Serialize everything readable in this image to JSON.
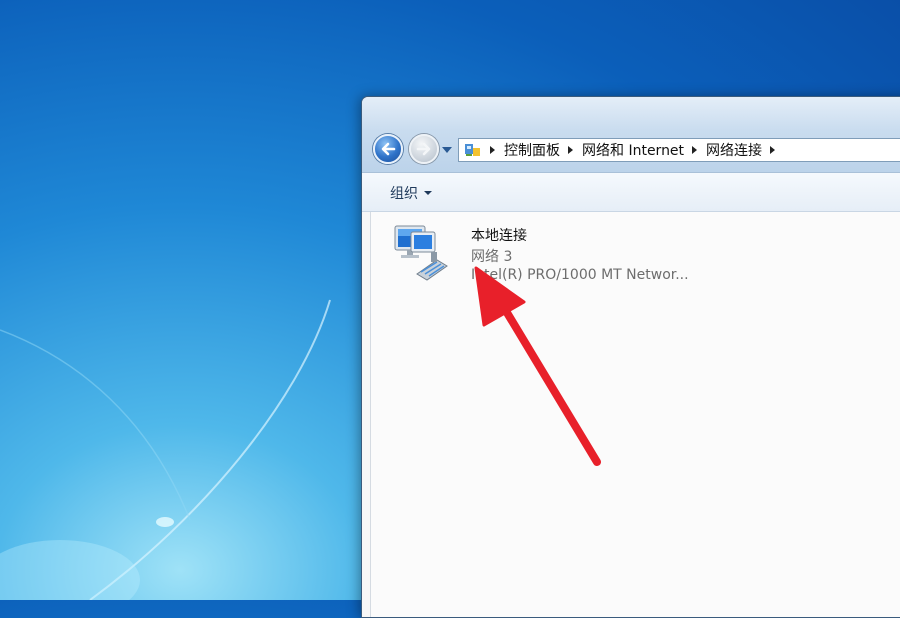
{
  "address_bar": {
    "crumbs": [
      "控制面板",
      "网络和 Internet",
      "网络连接"
    ]
  },
  "toolbar": {
    "organize_label": "组织"
  },
  "connection": {
    "name": "本地连接",
    "network": "网络 3",
    "adapter": "Intel(R) PRO/1000 MT Networ..."
  },
  "colors": {
    "annotation_arrow": "#e8202a",
    "desktop_blue": "#1f88d6"
  },
  "icons": {
    "back": "back-arrow-icon",
    "forward": "forward-arrow-icon",
    "address": "control-panel-icon",
    "connection": "network-adapter-icon"
  }
}
